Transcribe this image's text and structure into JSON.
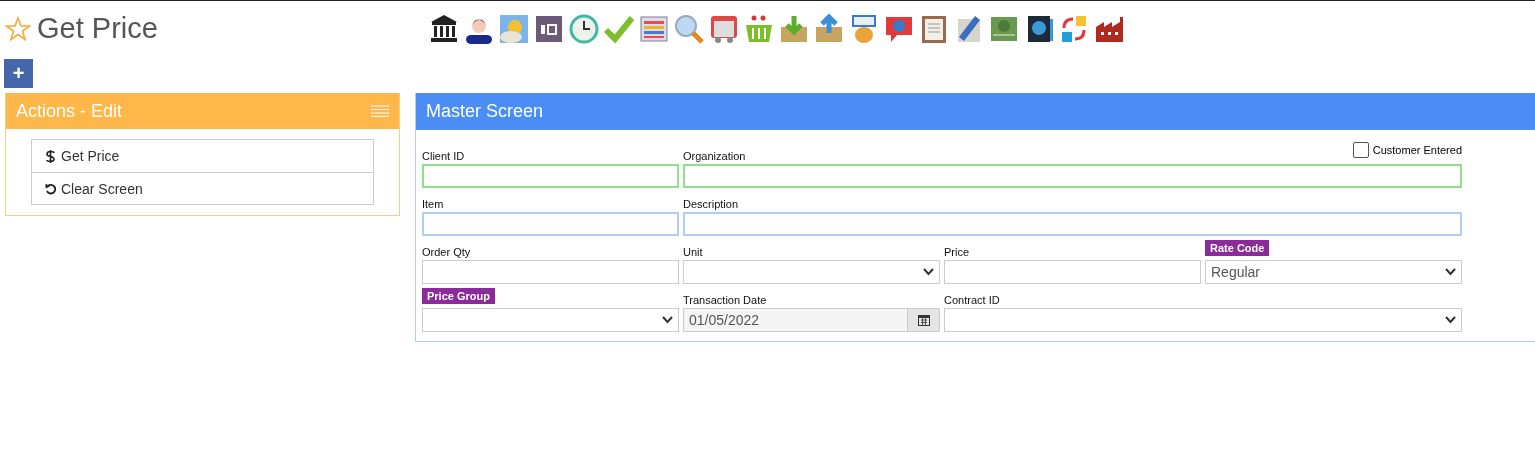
{
  "page": {
    "title": "Get Price",
    "favorite": false
  },
  "add_button": {
    "label": "+"
  },
  "actions_panel": {
    "title": "Actions - Edit",
    "items": [
      {
        "label": "Get Price",
        "kind": "dollar"
      },
      {
        "label": "Clear Screen",
        "kind": "undo"
      }
    ]
  },
  "master_panel": {
    "title": "Master Screen",
    "checkbox": {
      "label": "Customer Entered",
      "checked": false
    },
    "rows": [
      [
        {
          "label": "Client ID",
          "kind": "text",
          "valid": true,
          "focused": false,
          "badge": false
        },
        {
          "label": "Organization",
          "kind": "text",
          "valid": true,
          "focused": false,
          "badge": false
        }
      ],
      [
        {
          "label": "Item",
          "kind": "text",
          "valid": false,
          "focused": true,
          "badge": false
        },
        {
          "label": "Description",
          "kind": "text",
          "valid": false,
          "focused": true,
          "badge": false
        }
      ],
      [
        {
          "label": "Order Qty",
          "kind": "text",
          "valid": false,
          "focused": false,
          "badge": false
        },
        {
          "label": "Unit",
          "kind": "select",
          "valid": false,
          "focused": false,
          "badge": false
        },
        {
          "label": "Price",
          "kind": "text",
          "valid": false,
          "focused": false,
          "badge": false
        },
        {
          "label": "Rate Code",
          "kind": "select",
          "valid": false,
          "focused": false,
          "badge": true,
          "value": "Regular"
        }
      ],
      [
        {
          "label": "Price Group",
          "kind": "select",
          "valid": false,
          "focused": false,
          "badge": true
        },
        {
          "label": "Transaction Date",
          "kind": "date",
          "valid": false,
          "focused": false,
          "badge": false,
          "value": "01/05/2022"
        },
        {
          "label": "Contract ID",
          "kind": "select",
          "valid": false,
          "focused": false,
          "badge": false
        }
      ]
    ]
  }
}
